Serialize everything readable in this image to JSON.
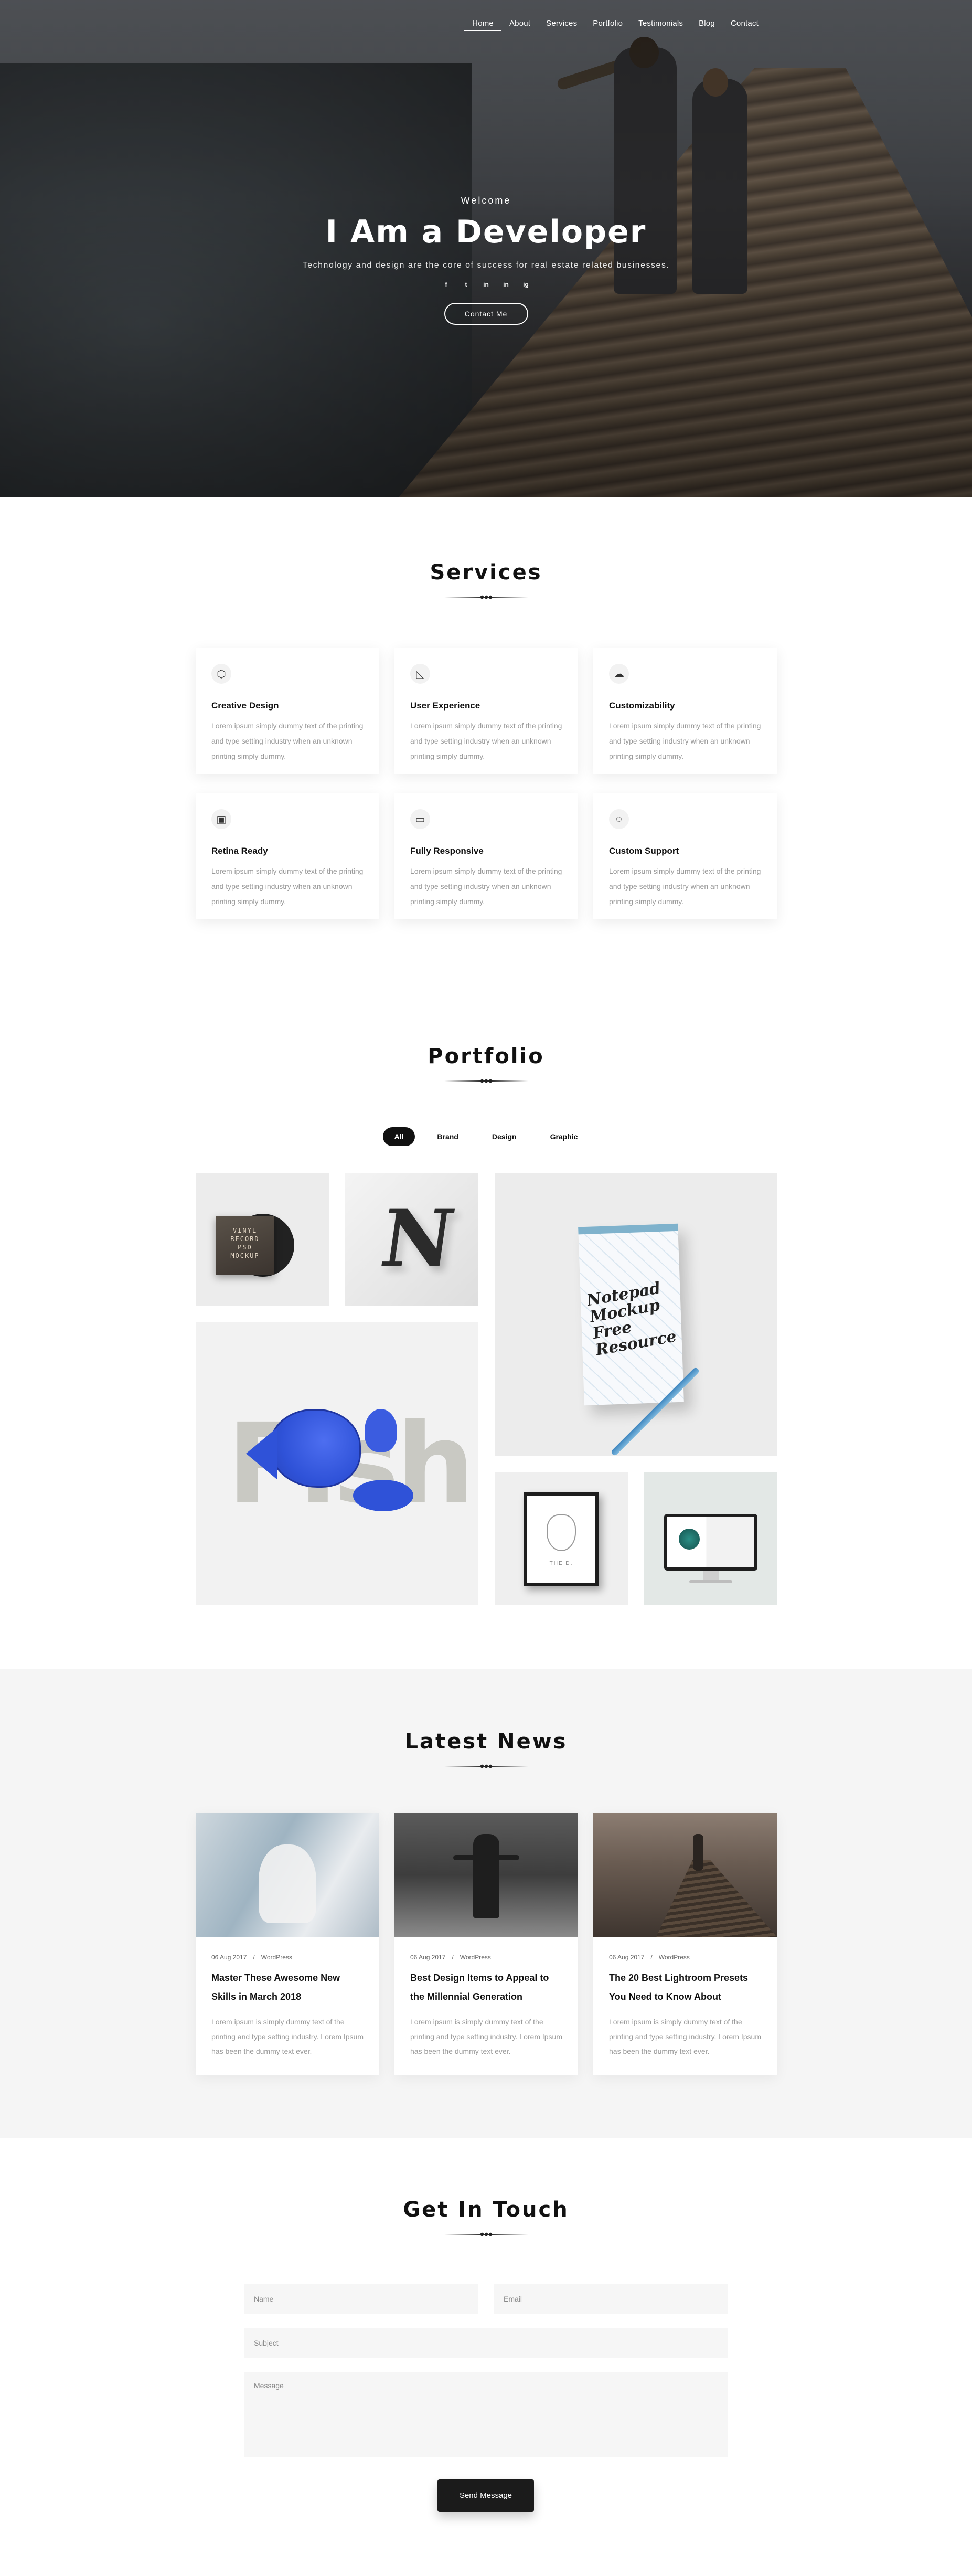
{
  "nav": [
    "Home",
    "About",
    "Services",
    "Portfolio",
    "Testimonials",
    "Blog",
    "Contact"
  ],
  "hero": {
    "welcome": "Welcome",
    "title": "I Am a Developer",
    "tagline": "Technology and design are the core of success for real estate related businesses.",
    "social": [
      "f",
      "t",
      "in",
      "in",
      "ig"
    ],
    "social_icons": [
      "facebook-icon",
      "twitter-icon",
      "linkedin-icon",
      "behance-icon",
      "instagram-icon"
    ],
    "cta": "Contact Me"
  },
  "services": {
    "title": "Services",
    "items": [
      {
        "icon": "cube-icon",
        "glyph": "⬡",
        "title": "Creative Design",
        "text": "Lorem ipsum simply dummy text of the printing and type setting industry when an unknown printing simply dummy."
      },
      {
        "icon": "ruler-triangle-icon",
        "glyph": "◺",
        "title": "User Experience",
        "text": "Lorem ipsum simply dummy text of the printing and type setting industry when an unknown printing simply dummy."
      },
      {
        "icon": "cloud-icon",
        "glyph": "☁",
        "title": "Customizability",
        "text": "Lorem ipsum simply dummy text of the printing and type setting industry when an unknown printing simply dummy."
      },
      {
        "icon": "image-icon",
        "glyph": "▣",
        "title": "Retina Ready",
        "text": "Lorem ipsum simply dummy text of the printing and type setting industry when an unknown printing simply dummy."
      },
      {
        "icon": "tablet-icon",
        "glyph": "▭",
        "title": "Fully Responsive",
        "text": "Lorem ipsum simply dummy text of the printing and type setting industry when an unknown printing simply dummy."
      },
      {
        "icon": "chat-support-icon",
        "glyph": "◌",
        "title": "Custom Support",
        "text": "Lorem ipsum simply dummy text of the printing and type setting industry when an unknown printing simply dummy."
      }
    ]
  },
  "portfolio": {
    "title": "Portfolio",
    "filters": [
      "All",
      "Brand",
      "Design",
      "Graphic"
    ],
    "active_filter": "All",
    "tiles": [
      {
        "name": "vinyl-record-mockup",
        "lines": [
          "VINYL",
          "RECORD",
          "PSD",
          "MOCKUP"
        ]
      },
      {
        "name": "3d-letter-logo",
        "letter": "N"
      },
      {
        "name": "notepad-mockup",
        "lines": [
          "Notepad",
          "Mockup",
          "Free",
          "Resource"
        ]
      },
      {
        "name": "fish-illustration",
        "word": "Fish"
      },
      {
        "name": "deer-poster-frame",
        "caption": "THE D."
      },
      {
        "name": "desktop-screen-mockup"
      }
    ]
  },
  "news": {
    "title": "Latest News",
    "posts": [
      {
        "date": "06 Aug 2017",
        "category": "WordPress",
        "title": "Master These Awesome New Skills in March 2018",
        "text": "Lorem ipsum is simply dummy text of the printing and type setting industry. Lorem Ipsum has been the dummy text ever."
      },
      {
        "date": "06 Aug 2017",
        "category": "WordPress",
        "title": "Best Design Items to Appeal to the Millennial Generation",
        "text": "Lorem ipsum is simply dummy text of the printing and type setting industry. Lorem Ipsum has been the dummy text ever."
      },
      {
        "date": "06 Aug 2017",
        "category": "WordPress",
        "title": "The 20 Best Lightroom Presets You Need to Know About",
        "text": "Lorem ipsum is simply dummy text of the printing and type setting industry. Lorem Ipsum has been the dummy text ever."
      }
    ]
  },
  "contact": {
    "title": "Get In Touch",
    "name_placeholder": "Name",
    "email_placeholder": "Email",
    "subject_placeholder": "Subject",
    "message_placeholder": "Message",
    "send": "Send Message"
  },
  "colors": {
    "accent": "#111111",
    "muted_text": "#9a9a9a",
    "news_bg": "#f5f5f5",
    "fish_blue": "#2f52d8"
  }
}
